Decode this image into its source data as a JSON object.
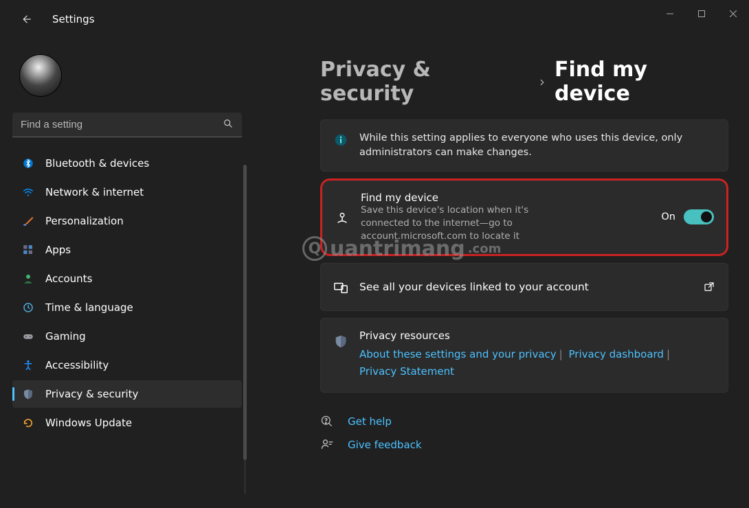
{
  "app": {
    "title": "Settings"
  },
  "search": {
    "placeholder": "Find a setting"
  },
  "sidebar": {
    "items": [
      {
        "label": "Bluetooth & devices"
      },
      {
        "label": "Network & internet"
      },
      {
        "label": "Personalization"
      },
      {
        "label": "Apps"
      },
      {
        "label": "Accounts"
      },
      {
        "label": "Time & language"
      },
      {
        "label": "Gaming"
      },
      {
        "label": "Accessibility"
      },
      {
        "label": "Privacy & security"
      },
      {
        "label": "Windows Update"
      }
    ]
  },
  "breadcrumb": {
    "parent": "Privacy & security",
    "current": "Find my device"
  },
  "info_banner": "While this setting applies to everyone who uses this device, only administrators can make changes.",
  "find_my_device": {
    "title": "Find my device",
    "description": "Save this device's location when it's connected to the internet—go to account.microsoft.com to locate it",
    "state_label": "On"
  },
  "linked_devices": "See all your devices linked to your account",
  "privacy_resources": {
    "title": "Privacy resources",
    "link1": "About these settings and your privacy",
    "link2": "Privacy dashboard",
    "link3": "Privacy Statement"
  },
  "footer": {
    "help": "Get help",
    "feedback": "Give feedback"
  },
  "watermark": "uantrimang"
}
